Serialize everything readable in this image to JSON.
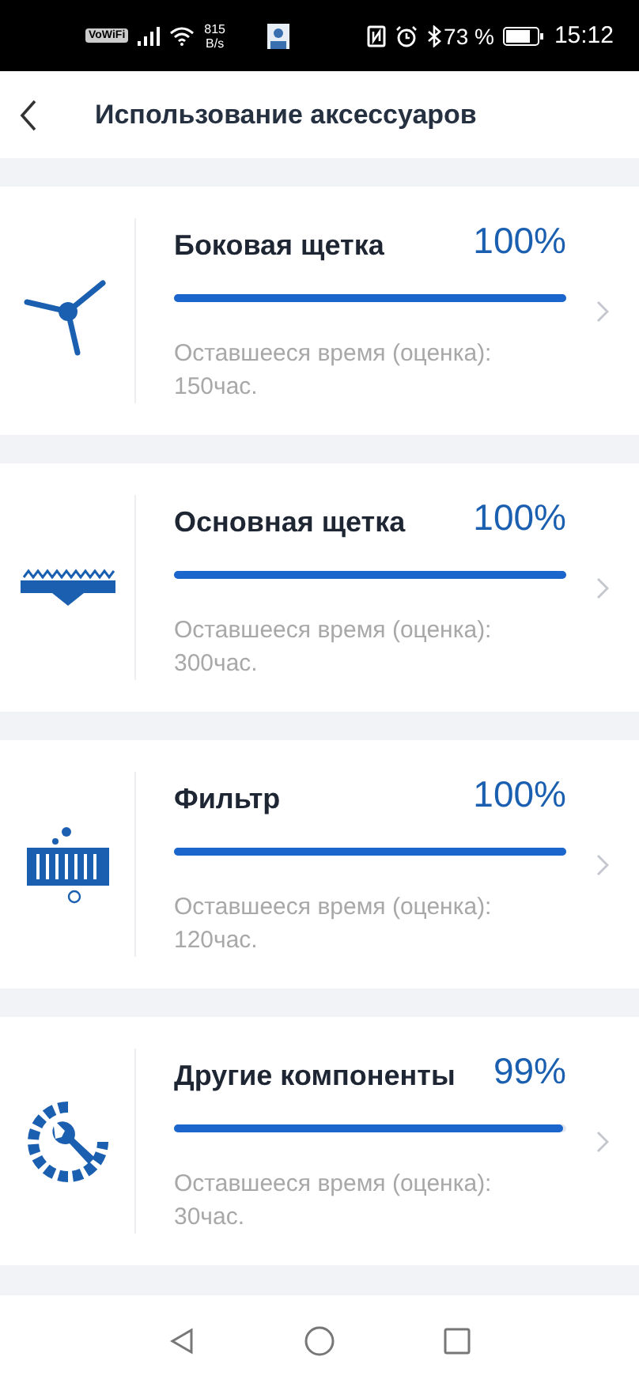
{
  "status_bar": {
    "vowifi": "VoWiFi",
    "speed": "815",
    "speed_unit": "B/s",
    "battery": "73 %",
    "time": "15:12"
  },
  "header": {
    "title": "Использование аксессуаров"
  },
  "items": [
    {
      "kind": "side_brush",
      "name": "Боковая щетка",
      "percent": "100%",
      "level": 1,
      "remaining": "Оставшееся время (оценка): 150час."
    },
    {
      "kind": "main_brush",
      "name": "Основная щетка",
      "percent": "100%",
      "level": 1,
      "remaining": "Оставшееся время (оценка): 300час."
    },
    {
      "kind": "filter",
      "name": "Фильтр",
      "percent": "100%",
      "level": 1,
      "remaining": "Оставшееся время (оценка): 120час."
    },
    {
      "kind": "other",
      "name": "Другие компоненты",
      "percent": "99%",
      "level": 0.99,
      "remaining": "Оставшееся время (оценка): 30час."
    }
  ]
}
